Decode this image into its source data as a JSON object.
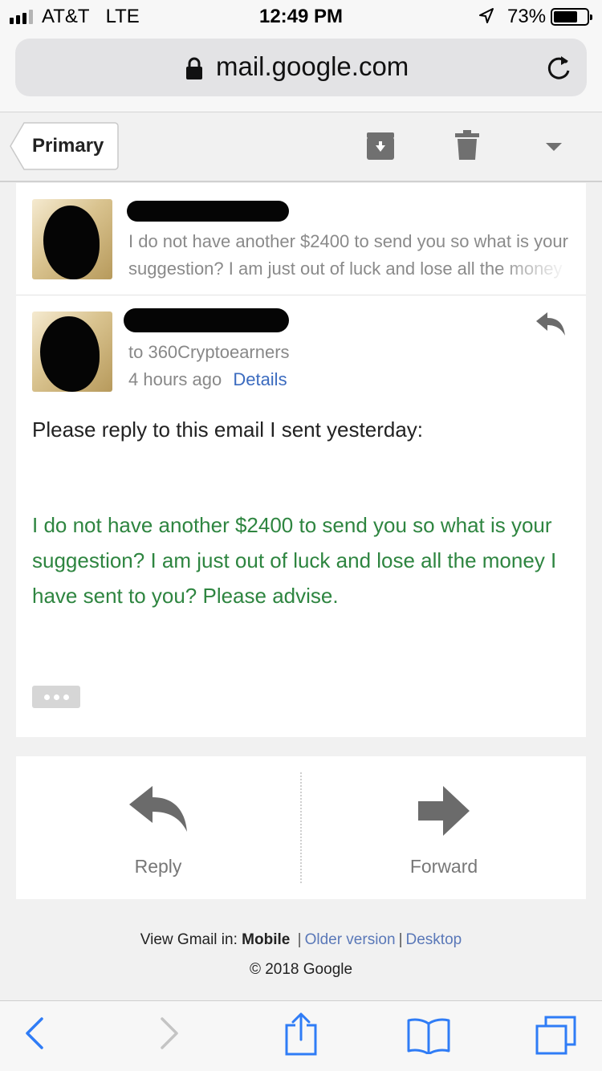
{
  "status_bar": {
    "carrier": "AT&T",
    "network": "LTE",
    "time": "12:49 PM",
    "battery": "73%",
    "battery_level": 0.73,
    "signal_bars": 3
  },
  "browser": {
    "url": "mail.google.com"
  },
  "toolbar": {
    "back_label": "Primary"
  },
  "thread": {
    "collapsed_message": {
      "snippet": "I do not have another $2400 to send you so what is your suggestion? I am just out of luck and lose all the money I have sent to you? Please advise."
    },
    "expanded_message": {
      "to_line": "to 360Cryptoearners",
      "time": "4 hours ago",
      "details_link": "Details",
      "body_intro": "Please reply to this email I sent yesterday:",
      "body_quote": "I do not have another $2400 to send you so what is your suggestion? I am just out of luck and lose all the money I have sent to you? Please advise."
    }
  },
  "actions": {
    "reply_label": "Reply",
    "forward_label": "Forward"
  },
  "footer": {
    "view_in": "View Gmail in:",
    "mobile": "Mobile",
    "older_version": "Older version",
    "desktop": "Desktop",
    "separator": "|",
    "copyright": "© 2018 Google"
  },
  "colors": {
    "quote_green": "#2e8540",
    "link_blue": "#3b6bbf",
    "safari_blue": "#2f7cf6"
  }
}
